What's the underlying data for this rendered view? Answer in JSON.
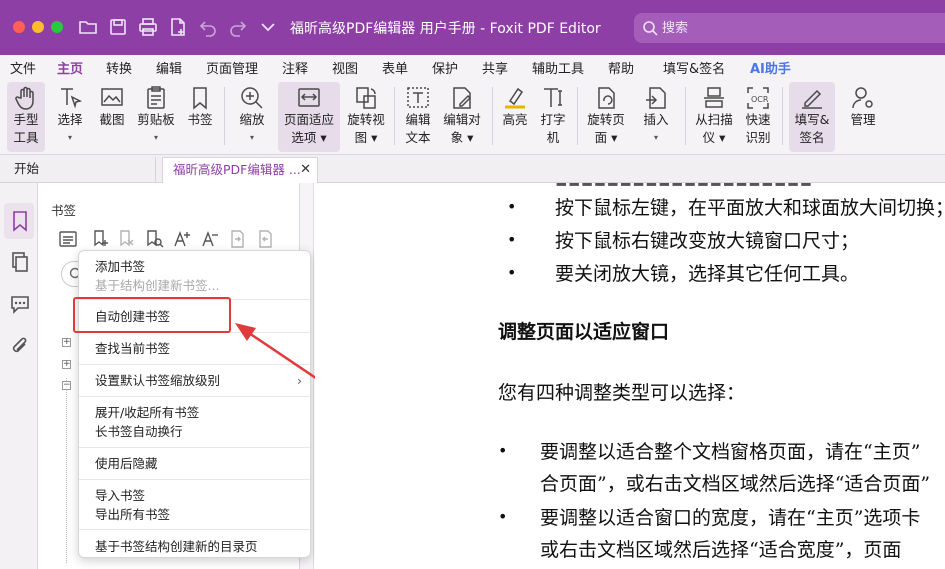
{
  "window": {
    "title": "福昕高级PDF编辑器 用户手册 - Foxit PDF Editor",
    "search_placeholder": "搜索"
  },
  "menu_tabs": [
    "文件",
    "主页",
    "转换",
    "编辑",
    "页面管理",
    "注释",
    "视图",
    "表单",
    "保护",
    "共享",
    "辅助工具",
    "帮助",
    "填写&签名",
    "AI助手"
  ],
  "active_menu_tab": "主页",
  "ribbon": {
    "hand_tool": [
      "手型",
      "工具"
    ],
    "select": [
      "选择",
      "▾"
    ],
    "snapshot": [
      "截图",
      ""
    ],
    "clipboard": [
      "剪贴板",
      "▾"
    ],
    "bookmark": [
      "书签",
      ""
    ],
    "zoom": [
      "缩放",
      "▾"
    ],
    "fit_page": [
      "页面适应",
      "选项 ▾"
    ],
    "rotate_view": [
      "旋转视",
      "图 ▾"
    ],
    "edit_text": [
      "编辑",
      "文本"
    ],
    "edit_object": [
      "编辑对",
      "象 ▾"
    ],
    "highlight": [
      "高亮",
      ""
    ],
    "typewriter": [
      "打字",
      "机"
    ],
    "rotate_page": [
      "旋转页",
      "面 ▾"
    ],
    "insert": [
      "插入",
      "▾"
    ],
    "from_scanner": [
      "从扫描",
      "仪 ▾"
    ],
    "ocr": [
      "快速",
      "识别"
    ],
    "fill_sign": [
      "填写&",
      "签名"
    ],
    "manage": [
      "管理",
      ""
    ]
  },
  "tabs": {
    "home": "开始",
    "file": "福昕高级PDF编辑器 ..."
  },
  "panel": {
    "title": "书签"
  },
  "context_menu": {
    "add_bookmark": "添加书签",
    "create_from_structure": "基于结构创建新书签...",
    "auto_create": "自动创建书签",
    "find_current": "查找当前书签",
    "set_zoom_level": "设置默认书签缩放级别",
    "expand_collapse": "展开/收起所有书签",
    "long_wrap": "长书签自动换行",
    "hide_after_use": "使用后隐藏",
    "import": "导入书签",
    "export": "导出所有书签",
    "toc_page": "基于书签结构创建新的目录页"
  },
  "document": {
    "b1": "按下鼠标左键，在平面放大和球面放大间切换；",
    "b2": "按下鼠标右键改变放大镜窗口尺寸；",
    "b3": "要关闭放大镜，选择其它任何工具。",
    "heading": "调整页面以适应窗口",
    "intro": "您有四种调整类型可以选择：",
    "p1a": "要调整以适合整个文档窗格页面，请在“主页”",
    "p1b": "合页面”，或右击文档区域然后选择“适合页面”",
    "p2a": "要调整以适合窗口的宽度，请在“主页”选项卡",
    "p2b": "或右击文档区域然后选择“适合宽度”，页面"
  },
  "colors": {
    "brand": "#8e3fa6",
    "ai": "#4a76e8",
    "annotation": "#e03a3a"
  }
}
